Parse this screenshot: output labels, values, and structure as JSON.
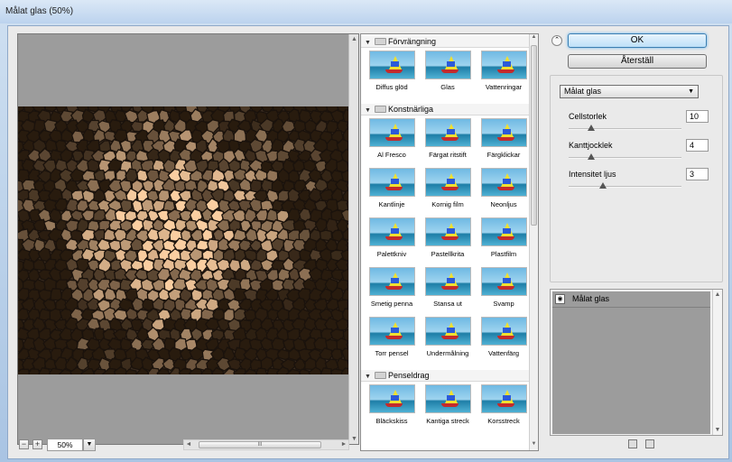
{
  "window": {
    "title": "Målat glas (50%)"
  },
  "preview": {
    "zoom": "50%",
    "zoom_out": "−",
    "zoom_in": "+"
  },
  "gallery": {
    "categories": [
      {
        "name": "Förvrängning",
        "items": [
          "Diffus glöd",
          "Glas",
          "Vattenringar"
        ]
      },
      {
        "name": "Konstnärliga",
        "items": [
          "Al Fresco",
          "Färgat ritstift",
          "Färgklickar",
          "Kantlinje",
          "Kornig film",
          "Neonljus",
          "Palettkniv",
          "Pastellkrita",
          "Plastfilm",
          "Smetig penna",
          "Stansa ut",
          "Svamp",
          "Torr pensel",
          "Undermålning",
          "Vattenfärg"
        ]
      },
      {
        "name": "Penseldrag",
        "items": [
          "Bläckskiss",
          "Kantiga streck",
          "Korsstreck"
        ]
      }
    ]
  },
  "buttons": {
    "ok": "OK",
    "reset": "Återställ"
  },
  "filter": {
    "selected": "Målat glas",
    "params": [
      {
        "label": "Cellstorlek",
        "value": "10",
        "level": 0.2
      },
      {
        "label": "Kanttjocklek",
        "value": "4",
        "level": 0.2
      },
      {
        "label": "Intensitet ljus",
        "value": "3",
        "level": 0.3
      }
    ]
  },
  "layers": {
    "items": [
      {
        "name": "Målat glas"
      }
    ]
  }
}
